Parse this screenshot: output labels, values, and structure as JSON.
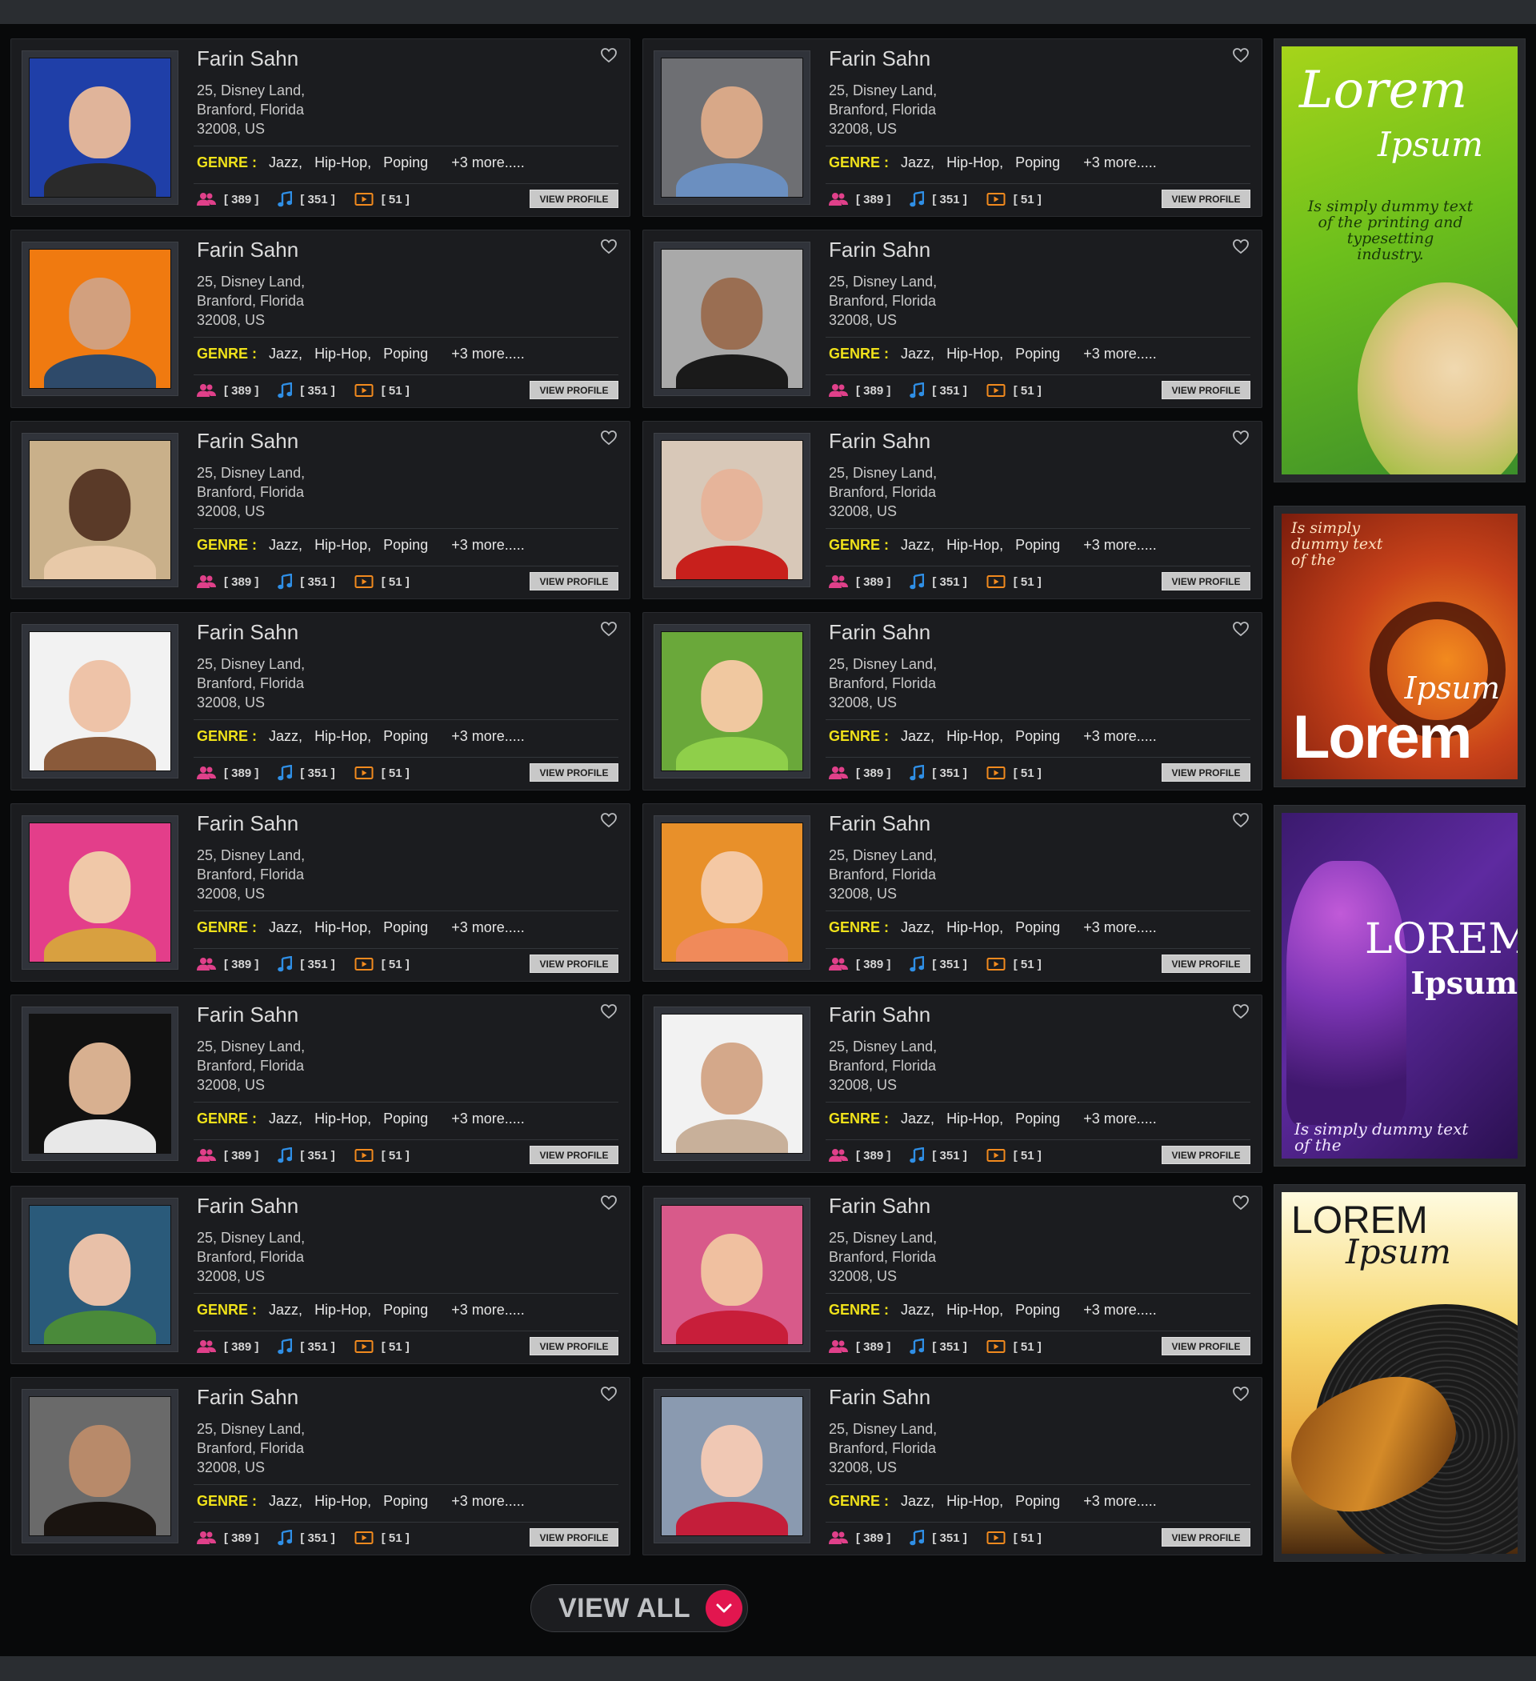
{
  "colors": {
    "accent": "#e2164f",
    "genre_label": "#f0e21a",
    "stat_people": "#e0408a",
    "stat_music": "#2f8fe6",
    "stat_video": "#f28a1e"
  },
  "cards": [
    {
      "name": "Farin Sahn",
      "addr1": "25, Disney Land,",
      "addr2": "Branford, Florida",
      "addr3": "32008, US",
      "genre_label": "GENRE :",
      "g1": "Jazz,",
      "g2": "Hip-Hop,",
      "g3": "Poping",
      "more": "+3 more.....",
      "s1": "[ 389 ]",
      "s2": "[ 351 ]",
      "s3": "[ 51 ]",
      "btn": "VIEW PROFILE"
    },
    {
      "name": "Farin Sahn",
      "addr1": "25, Disney Land,",
      "addr2": "Branford, Florida",
      "addr3": "32008, US",
      "genre_label": "GENRE :",
      "g1": "Jazz,",
      "g2": "Hip-Hop,",
      "g3": "Poping",
      "more": "+3 more.....",
      "s1": "[ 389 ]",
      "s2": "[ 351 ]",
      "s3": "[ 51 ]",
      "btn": "VIEW PROFILE"
    },
    {
      "name": "Farin Sahn",
      "addr1": "25, Disney Land,",
      "addr2": "Branford, Florida",
      "addr3": "32008, US",
      "genre_label": "GENRE :",
      "g1": "Jazz,",
      "g2": "Hip-Hop,",
      "g3": "Poping",
      "more": "+3 more.....",
      "s1": "[ 389 ]",
      "s2": "[ 351 ]",
      "s3": "[ 51 ]",
      "btn": "VIEW PROFILE"
    },
    {
      "name": "Farin Sahn",
      "addr1": "25, Disney Land,",
      "addr2": "Branford, Florida",
      "addr3": "32008, US",
      "genre_label": "GENRE :",
      "g1": "Jazz,",
      "g2": "Hip-Hop,",
      "g3": "Poping",
      "more": "+3 more.....",
      "s1": "[ 389 ]",
      "s2": "[ 351 ]",
      "s3": "[ 51 ]",
      "btn": "VIEW PROFILE"
    },
    {
      "name": "Farin Sahn",
      "addr1": "25, Disney Land,",
      "addr2": "Branford, Florida",
      "addr3": "32008, US",
      "genre_label": "GENRE :",
      "g1": "Jazz,",
      "g2": "Hip-Hop,",
      "g3": "Poping",
      "more": "+3 more.....",
      "s1": "[ 389 ]",
      "s2": "[ 351 ]",
      "s3": "[ 51 ]",
      "btn": "VIEW PROFILE"
    },
    {
      "name": "Farin Sahn",
      "addr1": "25, Disney Land,",
      "addr2": "Branford, Florida",
      "addr3": "32008, US",
      "genre_label": "GENRE :",
      "g1": "Jazz,",
      "g2": "Hip-Hop,",
      "g3": "Poping",
      "more": "+3 more.....",
      "s1": "[ 389 ]",
      "s2": "[ 351 ]",
      "s3": "[ 51 ]",
      "btn": "VIEW PROFILE"
    },
    {
      "name": "Farin Sahn",
      "addr1": "25, Disney Land,",
      "addr2": "Branford, Florida",
      "addr3": "32008, US",
      "genre_label": "GENRE :",
      "g1": "Jazz,",
      "g2": "Hip-Hop,",
      "g3": "Poping",
      "more": "+3 more.....",
      "s1": "[ 389 ]",
      "s2": "[ 351 ]",
      "s3": "[ 51 ]",
      "btn": "VIEW PROFILE"
    },
    {
      "name": "Farin Sahn",
      "addr1": "25, Disney Land,",
      "addr2": "Branford, Florida",
      "addr3": "32008, US",
      "genre_label": "GENRE :",
      "g1": "Jazz,",
      "g2": "Hip-Hop,",
      "g3": "Poping",
      "more": "+3 more.....",
      "s1": "[ 389 ]",
      "s2": "[ 351 ]",
      "s3": "[ 51 ]",
      "btn": "VIEW PROFILE"
    },
    {
      "name": "Farin Sahn",
      "addr1": "25, Disney Land,",
      "addr2": "Branford, Florida",
      "addr3": "32008, US",
      "genre_label": "GENRE :",
      "g1": "Jazz,",
      "g2": "Hip-Hop,",
      "g3": "Poping",
      "more": "+3 more.....",
      "s1": "[ 389 ]",
      "s2": "[ 351 ]",
      "s3": "[ 51 ]",
      "btn": "VIEW PROFILE"
    },
    {
      "name": "Farin Sahn",
      "addr1": "25, Disney Land,",
      "addr2": "Branford, Florida",
      "addr3": "32008, US",
      "genre_label": "GENRE :",
      "g1": "Jazz,",
      "g2": "Hip-Hop,",
      "g3": "Poping",
      "more": "+3 more.....",
      "s1": "[ 389 ]",
      "s2": "[ 351 ]",
      "s3": "[ 51 ]",
      "btn": "VIEW PROFILE"
    },
    {
      "name": "Farin Sahn",
      "addr1": "25, Disney Land,",
      "addr2": "Branford, Florida",
      "addr3": "32008, US",
      "genre_label": "GENRE :",
      "g1": "Jazz,",
      "g2": "Hip-Hop,",
      "g3": "Poping",
      "more": "+3 more.....",
      "s1": "[ 389 ]",
      "s2": "[ 351 ]",
      "s3": "[ 51 ]",
      "btn": "VIEW PROFILE"
    },
    {
      "name": "Farin Sahn",
      "addr1": "25, Disney Land,",
      "addr2": "Branford, Florida",
      "addr3": "32008, US",
      "genre_label": "GENRE :",
      "g1": "Jazz,",
      "g2": "Hip-Hop,",
      "g3": "Poping",
      "more": "+3 more.....",
      "s1": "[ 389 ]",
      "s2": "[ 351 ]",
      "s3": "[ 51 ]",
      "btn": "VIEW PROFILE"
    },
    {
      "name": "Farin Sahn",
      "addr1": "25, Disney Land,",
      "addr2": "Branford, Florida",
      "addr3": "32008, US",
      "genre_label": "GENRE :",
      "g1": "Jazz,",
      "g2": "Hip-Hop,",
      "g3": "Poping",
      "more": "+3 more.....",
      "s1": "[ 389 ]",
      "s2": "[ 351 ]",
      "s3": "[ 51 ]",
      "btn": "VIEW PROFILE"
    },
    {
      "name": "Farin Sahn",
      "addr1": "25, Disney Land,",
      "addr2": "Branford, Florida",
      "addr3": "32008, US",
      "genre_label": "GENRE :",
      "g1": "Jazz,",
      "g2": "Hip-Hop,",
      "g3": "Poping",
      "more": "+3 more.....",
      "s1": "[ 389 ]",
      "s2": "[ 351 ]",
      "s3": "[ 51 ]",
      "btn": "VIEW PROFILE"
    },
    {
      "name": "Farin Sahn",
      "addr1": "25, Disney Land,",
      "addr2": "Branford, Florida",
      "addr3": "32008, US",
      "genre_label": "GENRE :",
      "g1": "Jazz,",
      "g2": "Hip-Hop,",
      "g3": "Poping",
      "more": "+3 more.....",
      "s1": "[ 389 ]",
      "s2": "[ 351 ]",
      "s3": "[ 51 ]",
      "btn": "VIEW PROFILE"
    },
    {
      "name": "Farin Sahn",
      "addr1": "25, Disney Land,",
      "addr2": "Branford, Florida",
      "addr3": "32008, US",
      "genre_label": "GENRE :",
      "g1": "Jazz,",
      "g2": "Hip-Hop,",
      "g3": "Poping",
      "more": "+3 more.....",
      "s1": "[ 389 ]",
      "s2": "[ 351 ]",
      "s3": "[ 51 ]",
      "btn": "VIEW PROFILE"
    }
  ],
  "ads": {
    "ad1": {
      "title1": "Lorem",
      "title2": "Ipsum",
      "l1": "Is simply dummy text",
      "l2": "of the printing and",
      "l3": "typesetting",
      "l4": "industry."
    },
    "ad2": {
      "l1": "Is simply",
      "l2": "dummy text",
      "l3": "of the",
      "title2": "Ipsum",
      "title1": "Lorem"
    },
    "ad3": {
      "title1": "LOREM",
      "title2": "Ipsum",
      "l1": "Is simply dummy text",
      "l2": "of the"
    },
    "ad4": {
      "title1": "LOREM",
      "title2": "Ipsum"
    }
  },
  "view_all": {
    "label": "VIEW ALL",
    "icon": "chevron-down-icon"
  }
}
